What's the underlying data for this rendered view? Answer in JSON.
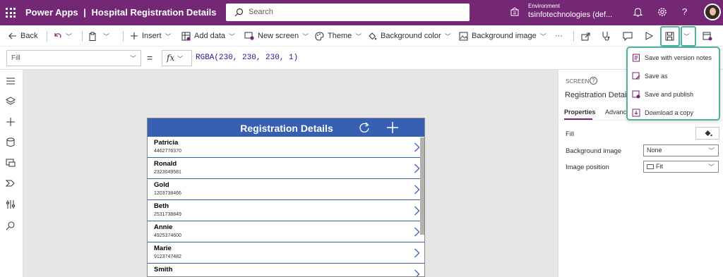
{
  "topbar": {
    "app_name": "Power Apps",
    "separator": "|",
    "app_title": "Hospital Registration Details",
    "search_placeholder": "Search",
    "environment_label": "Environment",
    "environment_name": "tsinfotechnologies (def..."
  },
  "toolbar": {
    "back": "Back",
    "insert": "Insert",
    "add_data": "Add data",
    "new_screen": "New screen",
    "theme": "Theme",
    "background_color": "Background color",
    "background_image": "Background image",
    "more": "···"
  },
  "formula_bar": {
    "property": "Fill",
    "equals": "=",
    "fx": "fx",
    "formula": "RGBA(230, 230, 230, 1)"
  },
  "save_menu": {
    "items": [
      {
        "label": "Save with version notes"
      },
      {
        "label": "Save as"
      },
      {
        "label": "Save and publish"
      },
      {
        "label": "Download a copy"
      }
    ]
  },
  "screen": {
    "title": "Registration Details",
    "rows": [
      {
        "name": "Patricia",
        "phone": "4462776370"
      },
      {
        "name": "Ronald",
        "phone": "2323049581"
      },
      {
        "name": "Gold",
        "phone": "1203738466"
      },
      {
        "name": "Beth",
        "phone": "2531738849"
      },
      {
        "name": "Annie",
        "phone": "4925374600"
      },
      {
        "name": "Marie",
        "phone": "9123747482"
      },
      {
        "name": "Smith",
        "phone": ""
      }
    ]
  },
  "right_panel": {
    "screen_label": "SCREEN",
    "help": "?",
    "screen_name": "Registration Details",
    "tab_properties": "Properties",
    "tab_advanced": "Advanced",
    "fill_label": "Fill",
    "background_image_label": "Background image",
    "background_image_value": "None",
    "image_position_label": "Image position",
    "image_position_value": "Fit"
  },
  "colors": {
    "brand": "#742774",
    "header_blue": "#3860b2",
    "canvas": "#e6e6e6",
    "highlight": "#4fb39f"
  },
  "icons": [
    "waffle-icon",
    "search-icon",
    "environment-icon",
    "bell-icon",
    "gear-icon",
    "help-icon",
    "back-icon",
    "undo-icon",
    "paste-icon",
    "plus-icon",
    "database-icon",
    "new-screen-icon",
    "palette-icon",
    "paint-bucket-icon",
    "image-icon",
    "share-icon",
    "app-checker-icon",
    "comment-icon",
    "play-icon",
    "save-icon",
    "publish-icon",
    "refresh-icon",
    "chevron-right-icon"
  ]
}
